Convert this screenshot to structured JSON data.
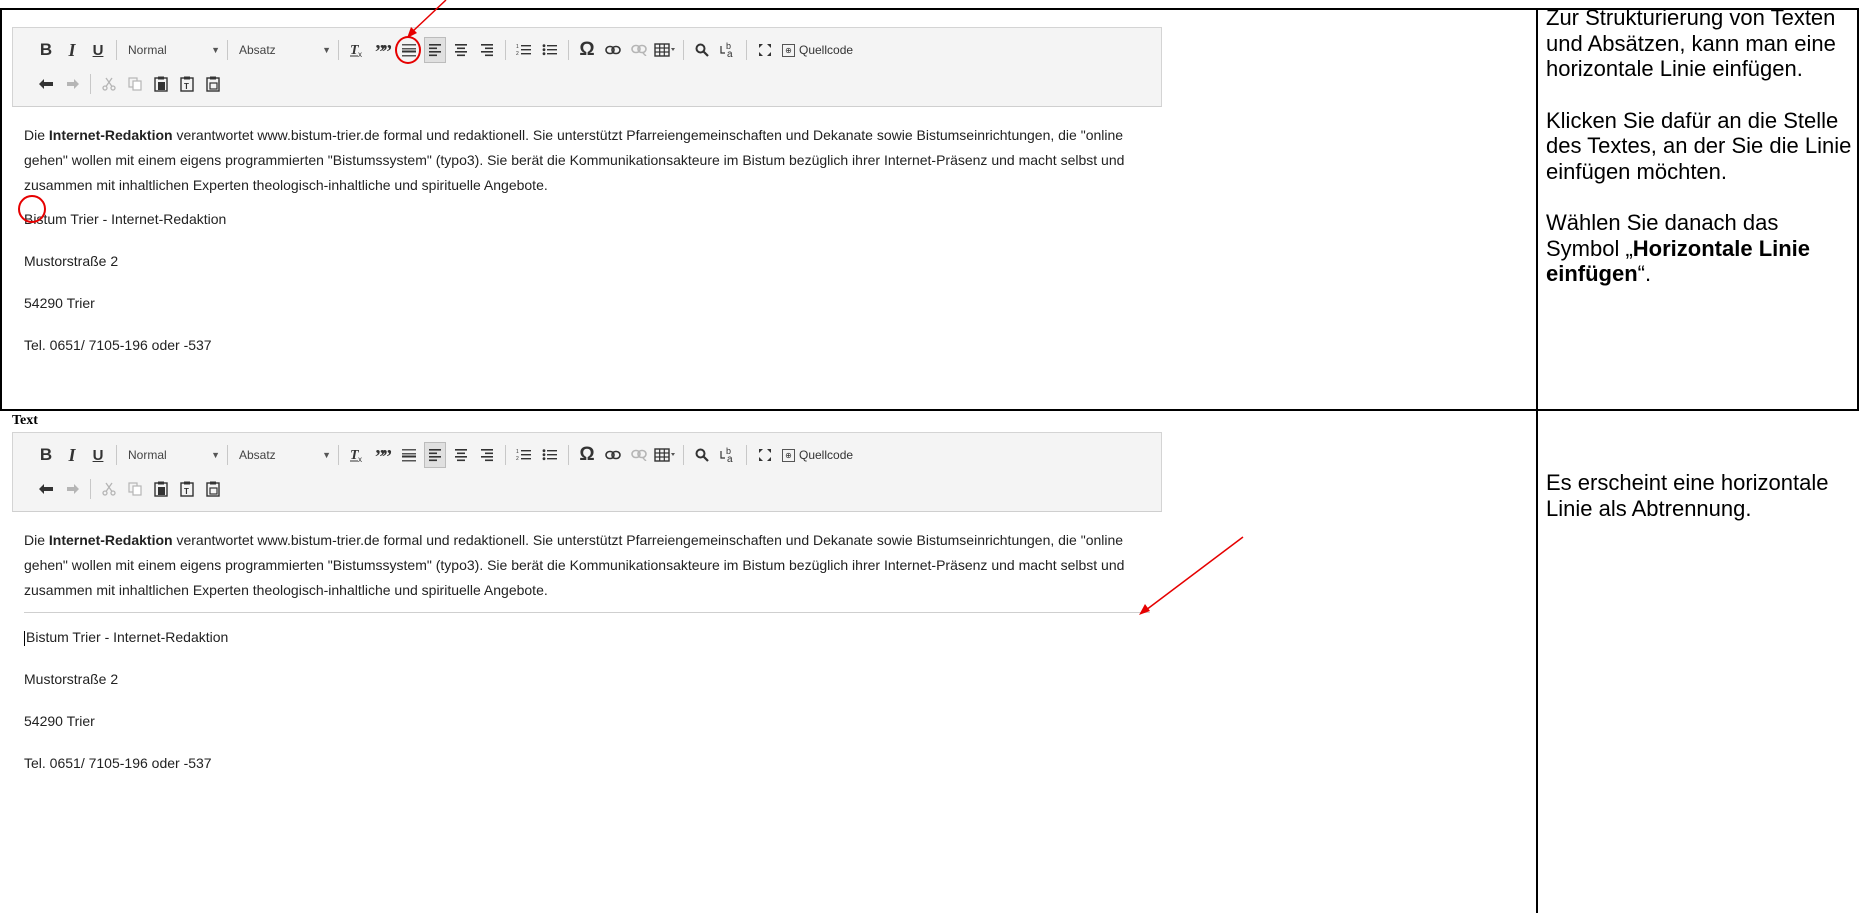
{
  "toolbar": {
    "bold_label": "B",
    "italic_label": "I",
    "underline_label": "U",
    "style_combo": "Normal",
    "format_combo": "Absatz",
    "clear_format_label": "Tx",
    "blockquote_label": "❞",
    "source_label": "Quellcode",
    "icons": [
      "bold-icon",
      "italic-icon",
      "underline-icon",
      "remove-format-icon",
      "blockquote-icon",
      "horizontal-rule-icon",
      "align-left-icon",
      "align-center-icon",
      "align-right-icon",
      "numbered-list-icon",
      "bulleted-list-icon",
      "special-char-icon",
      "link-icon",
      "unlink-icon",
      "table-icon",
      "find-icon",
      "replace-icon",
      "maximize-icon",
      "source-icon",
      "undo-icon",
      "redo-icon",
      "cut-icon",
      "copy-icon",
      "paste-icon",
      "paste-text-icon",
      "paste-word-icon"
    ]
  },
  "editor_content": {
    "intro_prefix": "Die ",
    "intro_bold": "Internet-Redaktion",
    "intro_rest": " verantwortet www.bistum-trier.de formal und redaktionell. Sie unterstützt Pfarreiengemeinschaften und Dekanate sowie Bistumseinrichtungen, die \"online gehen\" wollen mit einem eigens programmierten \"Bistumssystem\" (typo3). Sie berät die Kommunikationsakteure im Bistum bezüglich ihrer Internet-Präsenz und macht selbst und zusammen mit inhaltlichen Experten theologisch-inhaltliche und spirituelle Angebote.",
    "address_line1": "Bistum Trier - Internet-Redaktion",
    "address_line2": "Mustorstraße 2",
    "address_line3": "54290 Trier",
    "address_line4": "Tel. 0651/ 7105-196 oder -537"
  },
  "field_label": "Text",
  "instructions_1": {
    "p1": "Zur Strukturierung von Texten und Absätzen, kann man eine horizontale Linie einfügen.",
    "p2": "Klicken Sie dafür an die Stelle des Textes, an der Sie die Linie einfügen möchten.",
    "p3_prefix": "Wählen Sie danach das Symbol „",
    "p3_bold": "Horizontale Linie einfügen",
    "p3_suffix": "“."
  },
  "instructions_2": {
    "p1": "Es erscheint eine horizontale Linie als Abtrennung."
  },
  "colors": {
    "annotation_red": "#e60000",
    "toolbar_bg": "#f4f4f4",
    "border_black": "#000000"
  }
}
